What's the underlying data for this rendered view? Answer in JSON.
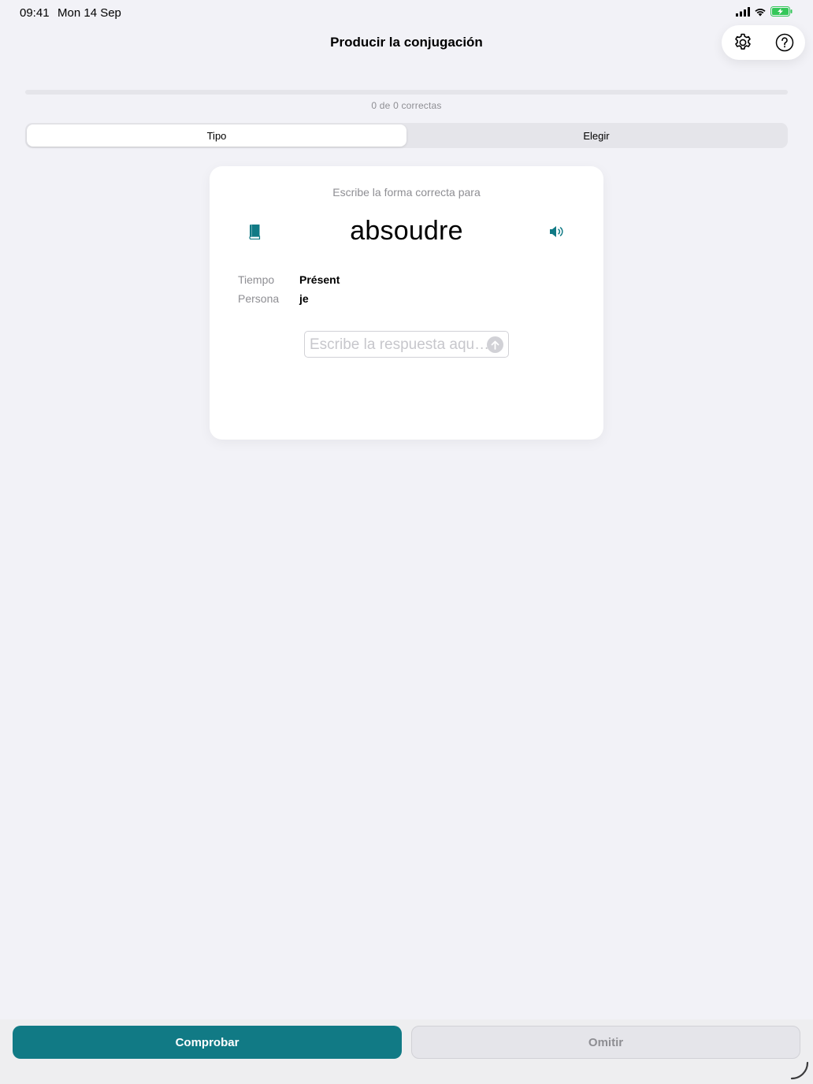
{
  "status": {
    "time": "09:41",
    "date": "Mon 14 Sep",
    "battery_color": "#34c759"
  },
  "nav": {
    "title": "Producir la conjugación",
    "settings_icon": "gear-icon",
    "help_icon": "question-circle-icon"
  },
  "progress": {
    "fraction": 0,
    "text": "0 de 0 correctas"
  },
  "mode": {
    "options": [
      "Tipo",
      "Elegir"
    ],
    "selected": "Tipo"
  },
  "card": {
    "prompt": "Escribe la forma correcta para",
    "verb": "absoudre",
    "tense_label": "Tiempo",
    "tense_value": "Présent",
    "person_label": "Persona",
    "person_value": "je",
    "answer_value": "",
    "answer_placeholder": "Escribe la respuesta aquí..."
  },
  "actions": {
    "check_label": "Comprobar",
    "skip_label": "Omitir"
  },
  "colors": {
    "accent": "#117a85",
    "background": "#f2f2f7"
  }
}
